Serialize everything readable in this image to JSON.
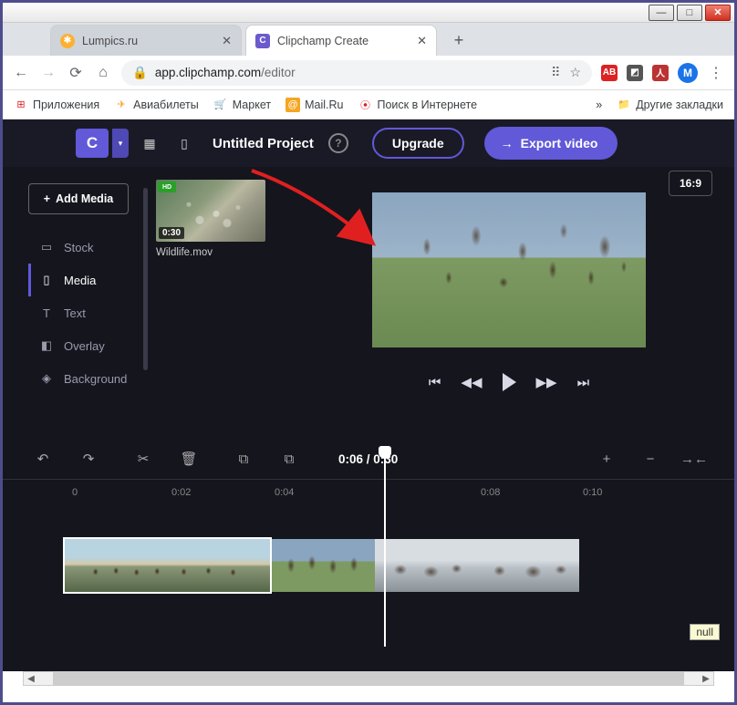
{
  "browser": {
    "tabs": [
      {
        "title": "Lumpics.ru"
      },
      {
        "title": "Clipchamp Create"
      }
    ],
    "url_host": "app.clipchamp.com",
    "url_path": "/editor",
    "profile_initial": "M",
    "bookmarks": {
      "apps": "Приложения",
      "avia": "Авиабилеты",
      "market": "Маркет",
      "mail": "Mail.Ru",
      "search": "Поиск в Интернете",
      "other": "Другие закладки"
    }
  },
  "topbar": {
    "logo": "C",
    "project": "Untitled Project",
    "upgrade": "Upgrade",
    "export": "Export video"
  },
  "sidebar": {
    "add_media": "Add Media",
    "items": [
      {
        "label": "Stock"
      },
      {
        "label": "Media"
      },
      {
        "label": "Text"
      },
      {
        "label": "Overlay"
      },
      {
        "label": "Background"
      }
    ]
  },
  "media": {
    "badge": "HD",
    "duration": "0:30",
    "filename": "Wildlife.mov"
  },
  "preview": {
    "aspect": "16:9"
  },
  "timeline": {
    "timecode": "0:06 / 0:30",
    "marks": {
      "m0": "0",
      "m1": "0:02",
      "m2": "0:04",
      "m4": "0:08",
      "m5": "0:10"
    }
  },
  "tooltip": "null"
}
